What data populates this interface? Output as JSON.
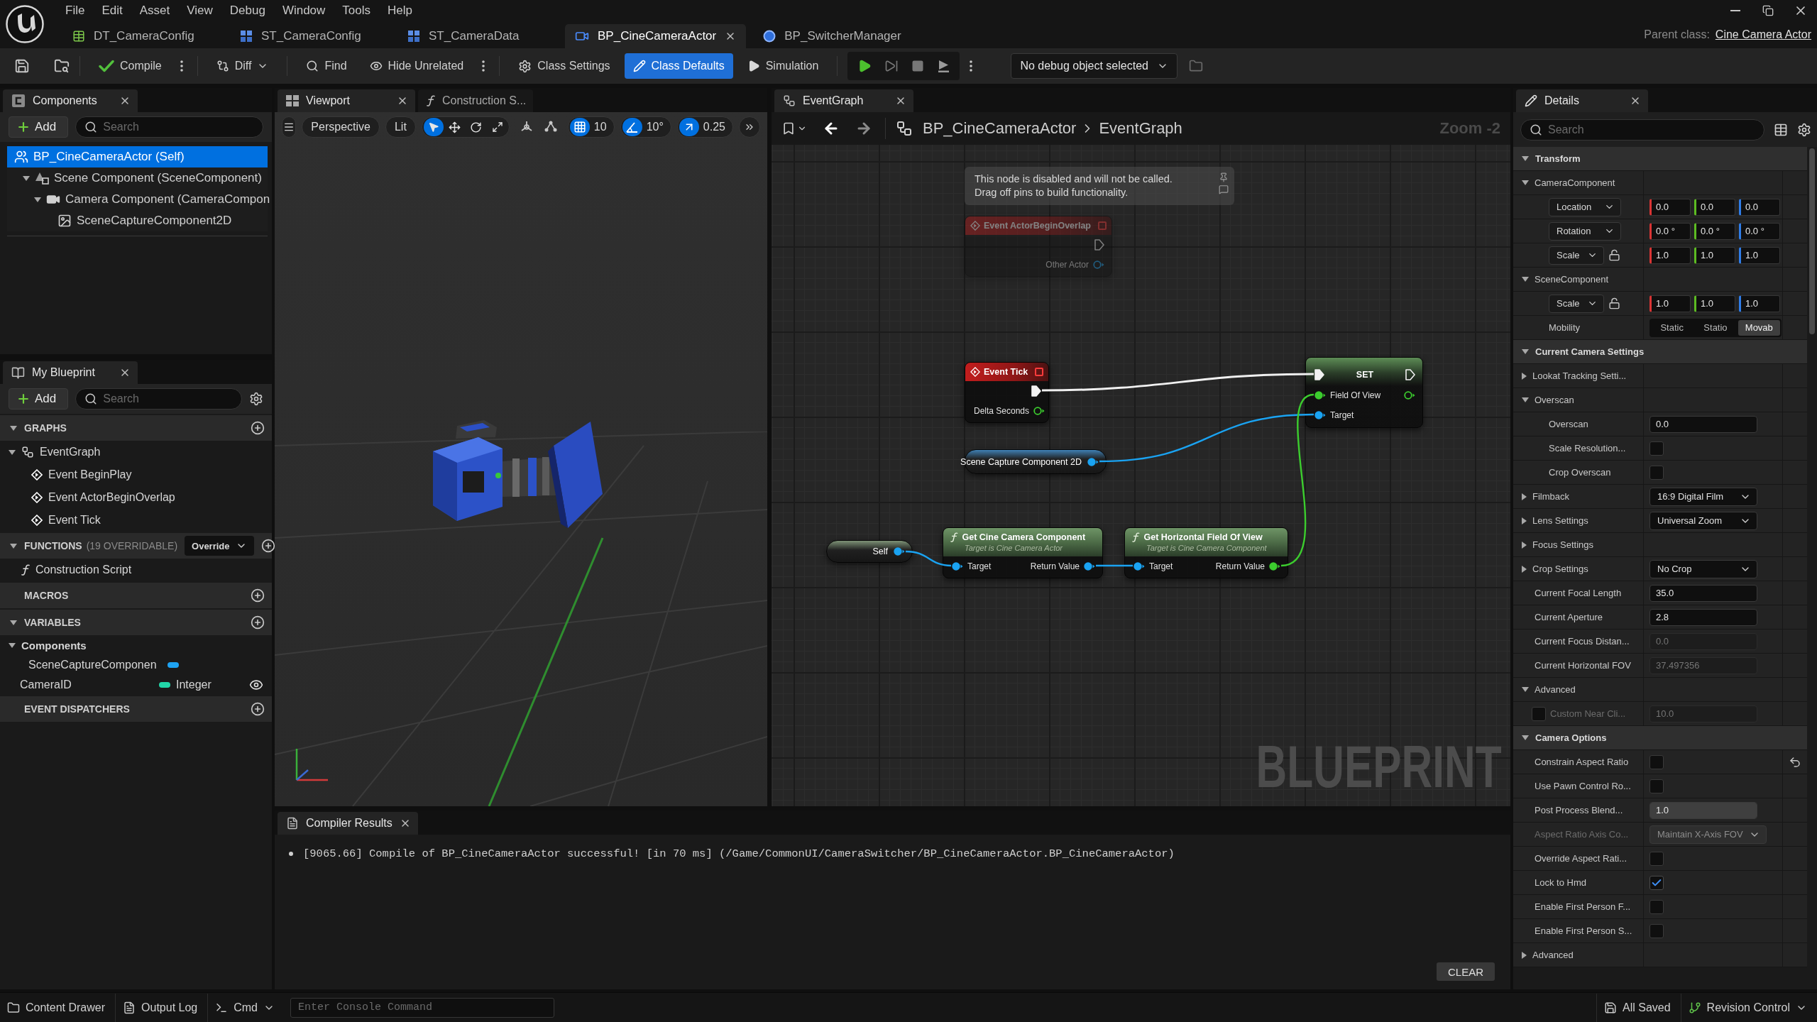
{
  "title_bar": {
    "menu": [
      "File",
      "Edit",
      "Asset",
      "View",
      "Debug",
      "Window",
      "Tools",
      "Help"
    ],
    "document_tabs": [
      {
        "label": "DT_CameraConfig",
        "kind": "data_table",
        "selected": false
      },
      {
        "label": "ST_CameraConfig",
        "kind": "structure",
        "selected": false
      },
      {
        "label": "ST_CameraData",
        "kind": "structure",
        "selected": false
      },
      {
        "label": "BP_CineCameraActor",
        "kind": "blueprint",
        "selected": true
      },
      {
        "label": "BP_SwitcherManager",
        "kind": "actor",
        "selected": false
      }
    ],
    "parent_class_label": "Parent class:",
    "parent_class": "Cine Camera Actor"
  },
  "toolbar": {
    "compile": "Compile",
    "diff": "Diff",
    "find": "Find",
    "hide_unrelated": "Hide Unrelated",
    "modes": [
      {
        "label": "Class Settings",
        "kind": "settings",
        "selected": false
      },
      {
        "label": "Class Defaults",
        "kind": "defaults",
        "selected": true
      },
      {
        "label": "Simulation",
        "kind": "simulation",
        "selected": false
      }
    ],
    "debug_object": "No debug object selected"
  },
  "components_panel": {
    "title": "Components",
    "add": "Add",
    "search_placeholder": "Search",
    "self": {
      "label": "BP_CineCameraActor (Self)",
      "selected": true
    },
    "tree": [
      {
        "label": "Scene Component (SceneComponent)",
        "kind": "scene",
        "selected": false,
        "expanded": true,
        "children": [
          {
            "label": "Camera Component (CameraCompon",
            "kind": "camera",
            "selected": false,
            "expanded": true,
            "children": [
              {
                "label": "SceneCaptureComponent2D",
                "kind": "capture",
                "selected": false
              }
            ]
          }
        ]
      }
    ]
  },
  "my_blueprint": {
    "title": "My Blueprint",
    "add": "Add",
    "search_placeholder": "Search",
    "sections": [
      {
        "title": "GRAPHS",
        "expanded": true,
        "items": [
          {
            "label": "EventGraph",
            "kind": "graph",
            "expanded": true,
            "children": [
              {
                "label": "Event BeginPlay",
                "kind": "event"
              },
              {
                "label": "Event ActorBeginOverlap",
                "kind": "event"
              },
              {
                "label": "Event Tick",
                "kind": "event"
              }
            ]
          }
        ]
      },
      {
        "title": "FUNCTIONS",
        "note": "(19 OVERRIDABLE)",
        "override": "Override",
        "expanded": true,
        "items": [
          {
            "label": "Construction Script",
            "kind": "function"
          }
        ]
      },
      {
        "title": "MACROS"
      },
      {
        "title": "VARIABLES",
        "expanded": true,
        "items": [
          {
            "label": "Components",
            "kind": "category",
            "expanded": true,
            "children": [
              {
                "label": "SceneCaptureComponen",
                "kind": "variable",
                "color": "#1ea3f2",
                "public": false
              }
            ]
          },
          {
            "label": "CameraID",
            "kind": "variable",
            "type": "Integer",
            "color": "#22d6a8",
            "public": true
          }
        ]
      },
      {
        "title": "EVENT DISPATCHERS"
      }
    ]
  },
  "viewport": {
    "tabs": [
      {
        "label": "Viewport",
        "kind": "viewport",
        "selected": true
      },
      {
        "label": "Construction S...",
        "kind": "function",
        "selected": false
      }
    ],
    "view_mode": "Perspective",
    "lighting": "Lit",
    "tools": [
      {
        "kind": "select",
        "selected": true
      },
      {
        "kind": "move",
        "selected": false
      },
      {
        "kind": "rotate",
        "selected": false
      },
      {
        "kind": "scale",
        "selected": false
      }
    ],
    "snaps": [
      {
        "kind": "grid",
        "value": "10",
        "on": true
      },
      {
        "kind": "angle",
        "value": "10°",
        "on": true
      },
      {
        "kind": "scale",
        "value": "0.25",
        "on": true
      }
    ]
  },
  "event_graph": {
    "tab": "EventGraph",
    "breadcrumb": [
      "BP_CineCameraActor",
      "EventGraph"
    ],
    "zoom": "Zoom -2",
    "corner_label": "BLUEPRINT",
    "nodes": [
      {
        "kind": "comment",
        "lines": [
          "This node is disabled and will not be called.",
          "Drag off pins to build functionality."
        ]
      },
      {
        "kind": "event",
        "title": "Event ActorBeginOverlap",
        "disabled": true,
        "rows": [
          {
            "out": {
              "kind": "exec",
              "connected": false
            }
          },
          {
            "out": {
              "kind": "object",
              "label": "Other Actor",
              "connected": false
            }
          }
        ]
      },
      {
        "kind": "event",
        "title": "Event Tick",
        "disabled": false,
        "rows": [
          {
            "out": {
              "kind": "exec",
              "connected": true
            }
          },
          {
            "out": {
              "kind": "float",
              "label": "Delta Seconds",
              "connected": false
            }
          }
        ]
      },
      {
        "kind": "set",
        "title": "SET",
        "rows": [
          {
            "in": {
              "kind": "exec",
              "connected": true
            },
            "out": {
              "kind": "exec",
              "connected": false
            }
          },
          {
            "in": {
              "kind": "float",
              "label": "Field Of View",
              "connected": true
            },
            "out": {
              "kind": "float",
              "connected": false
            }
          },
          {
            "in": {
              "kind": "object",
              "label": "Target",
              "connected": true
            }
          }
        ]
      },
      {
        "kind": "variable",
        "title": "Scene Capture Component 2D",
        "rows": [
          {
            "out": {
              "kind": "object",
              "connected": true
            }
          }
        ]
      },
      {
        "kind": "self",
        "title": "Self",
        "rows": [
          {
            "out": {
              "kind": "object",
              "connected": true
            }
          }
        ]
      },
      {
        "kind": "function",
        "title": "Get Cine Camera Component",
        "subtitle": "Target is Cine Camera Actor",
        "rows": [
          {
            "in": {
              "kind": "object",
              "label": "Target",
              "connected": true
            },
            "out": {
              "kind": "object",
              "label": "Return Value",
              "connected": true
            }
          }
        ]
      },
      {
        "kind": "function",
        "title": "Get Horizontal Field Of View",
        "subtitle": "Target is Cine Camera Component",
        "rows": [
          {
            "in": {
              "kind": "object",
              "label": "Target",
              "connected": true
            },
            "out": {
              "kind": "float",
              "label": "Return Value",
              "connected": true
            }
          }
        ]
      }
    ]
  },
  "compiler_results": {
    "title": "Compiler Results",
    "messages": [
      "[9065.66] Compile of BP_CineCameraActor successful! [in 70 ms] (/Game/CommonUI/CameraSwitcher/BP_CineCameraActor.BP_CineCameraActor)"
    ],
    "clear": "CLEAR"
  },
  "details": {
    "title": "Details",
    "search_placeholder": "Search",
    "sections": [
      {
        "title": "Transform",
        "expanded": true,
        "rows": [
          {
            "kind": "group",
            "label": "CameraComponent",
            "expanded": true,
            "children": [
              {
                "kind": "vector",
                "mode": "Location",
                "values": [
                  "0.0",
                  "0.0",
                  "0.0"
                ]
              },
              {
                "kind": "vector",
                "mode": "Rotation",
                "values": [
                  "0.0 °",
                  "0.0 °",
                  "0.0 °"
                ]
              },
              {
                "kind": "vector",
                "mode": "Scale",
                "values": [
                  "1.0",
                  "1.0",
                  "1.0"
                ],
                "ratio_locked": false
              }
            ]
          },
          {
            "kind": "group",
            "label": "SceneComponent",
            "expanded": true,
            "children": [
              {
                "kind": "vector",
                "mode": "Scale",
                "values": [
                  "1.0",
                  "1.0",
                  "1.0"
                ],
                "ratio_locked": false
              },
              {
                "kind": "segmented",
                "label": "Mobility",
                "options": [
                  {
                    "label": "Static",
                    "selected": false
                  },
                  {
                    "label": "Statio",
                    "selected": false
                  },
                  {
                    "label": "Movab",
                    "selected": true
                  }
                ]
              }
            ]
          }
        ]
      },
      {
        "title": "Current Camera Settings",
        "expanded": true,
        "rows": [
          {
            "kind": "group",
            "label": "Lookat Tracking Setti...",
            "expanded": false
          },
          {
            "kind": "group",
            "label": "Overscan",
            "expanded": true,
            "children": [
              {
                "kind": "number",
                "label": "Overscan",
                "value": "0.0",
                "disabled": false
              },
              {
                "kind": "checkbox",
                "label": "Scale Resolution...",
                "checked": false
              },
              {
                "kind": "checkbox",
                "label": "Crop Overscan",
                "checked": false
              }
            ]
          },
          {
            "kind": "group",
            "label": "Filmback",
            "expanded": false,
            "value": "16:9 Digital Film"
          },
          {
            "kind": "group",
            "label": "Lens Settings",
            "expanded": false,
            "value": "Universal Zoom"
          },
          {
            "kind": "group",
            "label": "Focus Settings",
            "expanded": false
          },
          {
            "kind": "group",
            "label": "Crop Settings",
            "expanded": false,
            "value": "No Crop"
          },
          {
            "kind": "number",
            "label": "Current Focal Length",
            "value": "35.0",
            "disabled": false
          },
          {
            "kind": "number",
            "label": "Current Aperture",
            "value": "2.8",
            "disabled": false
          },
          {
            "kind": "number",
            "label": "Current Focus Distan...",
            "value": "0.0",
            "disabled": true
          },
          {
            "kind": "number",
            "label": "Current Horizontal FOV",
            "value": "37.497356",
            "disabled": true
          },
          {
            "kind": "group",
            "label": "Advanced",
            "expanded": true,
            "children": [
              {
                "kind": "toggled_number",
                "label": "Custom Near Cli...",
                "checked": false,
                "value": "10.0",
                "disabled": true
              }
            ]
          }
        ]
      },
      {
        "title": "Camera Options",
        "expanded": true,
        "rows": [
          {
            "kind": "checkbox",
            "label": "Constrain Aspect Ratio",
            "checked": false,
            "modified": true
          },
          {
            "kind": "checkbox",
            "label": "Use Pawn Control Ro...",
            "checked": false
          },
          {
            "kind": "slider",
            "label": "Post Process Blend...",
            "value": "1.0",
            "level": 1
          },
          {
            "kind": "dropdown",
            "label": "Aspect Ratio Axis Co...",
            "value": "Maintain X-Axis FOV",
            "disabled": true
          },
          {
            "kind": "checkbox",
            "label": "Override Aspect Rati...",
            "checked": false
          },
          {
            "kind": "checkbox",
            "label": "Lock to Hmd",
            "checked": true
          },
          {
            "kind": "checkbox",
            "label": "Enable First Person F...",
            "checked": false
          },
          {
            "kind": "checkbox",
            "label": "Enable First Person S...",
            "checked": false
          },
          {
            "kind": "group",
            "label": "Advanced",
            "expanded": false
          }
        ]
      }
    ]
  },
  "status_bar": {
    "content_drawer": "Content Drawer",
    "output_log": "Output Log",
    "cmd": "Cmd",
    "console_placeholder": "Enter Console Command",
    "saved": "All Saved",
    "revision_control": "Revision Control"
  }
}
